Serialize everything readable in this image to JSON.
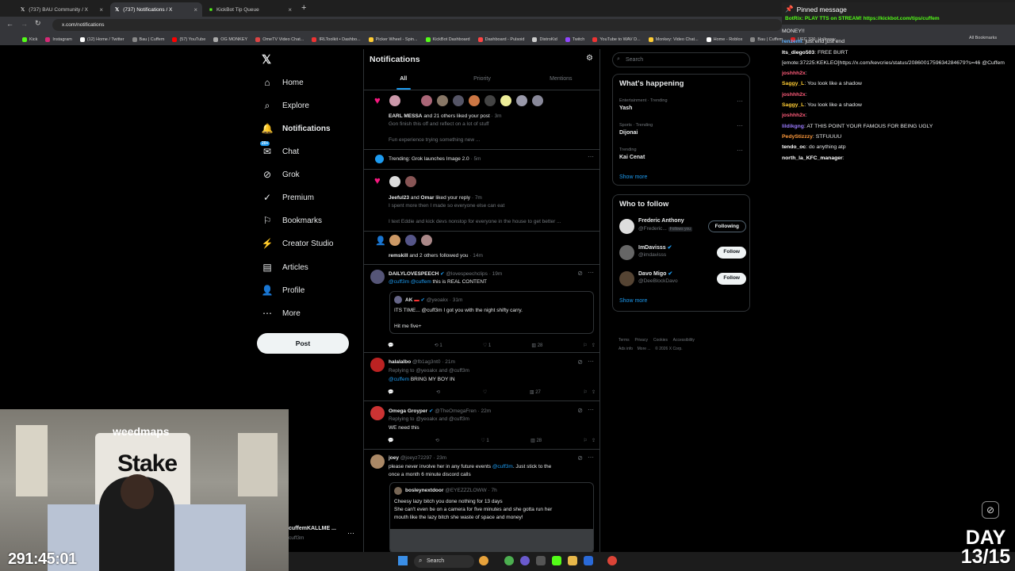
{
  "browser": {
    "tabs": [
      {
        "title": "(737) BAU Community / X",
        "active": false
      },
      {
        "title": "(737) Notifications / X",
        "active": true
      },
      {
        "title": "KickBot Tip Queue",
        "active": false
      }
    ],
    "new_tab": "+",
    "url": "x.com/notifications",
    "bookmarks": [
      "Kick",
      "Instagram",
      "(12) Home / Twitter",
      "Bau | Cuffem",
      "(57) YouTube",
      "OG MONKEY",
      "OmeTV Video Chat...",
      "IRLToolkit • Dashbo...",
      "Picker Wheel - Spin...",
      "KickBot Dashboard",
      "Dashboard - Pulsoid",
      "DistroKid",
      "Twitch",
      "YouTube to WAV D...",
      "Monkey: Video Chat...",
      "Home - Roblox",
      "Bau | Cuffem",
      "UFC 326: Holloway..."
    ],
    "all_bookmarks": "All Bookmarks"
  },
  "pinned": {
    "label": "Pinned message",
    "message": "BotRix: PLAY TTS on STREAM! https://kickbot.com/tips/cuffem"
  },
  "nav": {
    "items": [
      {
        "label": "Home",
        "icon": "home-icon"
      },
      {
        "label": "Explore",
        "icon": "search-icon"
      },
      {
        "label": "Notifications",
        "icon": "bell-icon"
      },
      {
        "label": "Chat",
        "icon": "chat-icon",
        "badge": "20+"
      },
      {
        "label": "Grok",
        "icon": "grok-icon"
      },
      {
        "label": "Premium",
        "icon": "premium-icon"
      },
      {
        "label": "Bookmarks",
        "icon": "bookmark-icon"
      },
      {
        "label": "Creator Studio",
        "icon": "creator-studio-icon"
      },
      {
        "label": "Articles",
        "icon": "articles-icon"
      },
      {
        "label": "Profile",
        "icon": "profile-icon"
      },
      {
        "label": "More",
        "icon": "more-icon"
      }
    ],
    "post": "Post",
    "account_name": "cuffemKALLME ...",
    "account_handle": "cuff3m"
  },
  "main": {
    "title": "Notifications",
    "tabs": [
      "All",
      "Priority",
      "Mentions"
    ],
    "n1": {
      "actor": "EARL MESSA",
      "action": "and 21 others liked your post",
      "time": "· 3m",
      "line1": "Gon finish this off and reflect on a lot of stuff",
      "line2": "Fun experience trying something new ..."
    },
    "n2": {
      "text": "Trending: Grok launches Image 2.0",
      "time": "· 5m"
    },
    "n3": {
      "actor": "Jeeful23",
      "and": "and",
      "actor2": "Omar",
      "action": "liked your reply",
      "time": "· 7m",
      "line1": "I spent more then I made so everyone else can eat",
      "line2": "I text Eddie and kick devs nonstop for everyone in the house to get better ..."
    },
    "n4": {
      "actor": "remskill",
      "action": "and 2 others followed you",
      "time": "· 14m"
    },
    "t1": {
      "name": "DAILYLOVESPEECH",
      "handle": "@lovespeechclips · 19m",
      "m1": "@cuff3m",
      "m2": "@cuffem",
      "text": "this is REAL CONTENT",
      "quote": {
        "name": "AK",
        "handle": "@yeoakx · 31m",
        "line1": "ITS TIME... @cuff3m I got you with the night shifty carry.",
        "line2": "Hit me five+"
      },
      "stats": {
        "retweets": "1",
        "likes": "1",
        "views": "28"
      }
    },
    "t2": {
      "name": "halalalbo",
      "handle": "@fb1ag3nt0 · 21m",
      "reply": "Replying to @yeoakx and @cuff3m",
      "mention": "@cuffem",
      "text": "BRING MY BOY IN",
      "stats": {
        "views": "27"
      }
    },
    "t3": {
      "name": "Omega Groyper",
      "handle": "@TheOmegaFren · 22m",
      "reply": "Replying to @yeoakx and @cuff3m",
      "text": "WE need this",
      "stats": {
        "likes": "1",
        "views": "28"
      }
    },
    "t4": {
      "name": "joey",
      "handle": "@joeyz72297 · 23m",
      "t1": "please never involve her in any future events",
      "mention": "@cuff3m",
      "t2": ". Just stick to the",
      "t3": "once a month 6 minute discord calls",
      "quote": {
        "name": "bosleynextdoor",
        "handle": "@EYEZZZLOWW · 7h",
        "l1": "Cheesy lazy bitch you done nothing for 13  days",
        "l2": "She can't even be on a camera for five minutes and she gotta run her",
        "l3": "mouth like the lazy bitch she waste of space and money!"
      }
    }
  },
  "right": {
    "search_placeholder": "Search",
    "happening_title": "What's happening",
    "trends": [
      {
        "category": "Entertainment · Trending",
        "name": "Yash"
      },
      {
        "category": "Sports · Trending",
        "name": "Dijonai"
      },
      {
        "category": "Trending",
        "name": "Kai Cenat"
      }
    ],
    "show_more": "Show more",
    "follow_title": "Who to follow",
    "who": [
      {
        "name": "Frederic Anthony",
        "handle": "@Frederic...",
        "tag": "Follows you",
        "button": "Following"
      },
      {
        "name": "ImDavisss",
        "handle": "@imdavisss",
        "button": "Follow"
      },
      {
        "name": "Davo Migo",
        "handle": "@DeeBlockDavo",
        "button": "Follow"
      }
    ],
    "footer1": "Terms     Privacy     Cookies     Accessibility",
    "footer2": "Ads info    More ...    © 2026 X Corp."
  },
  "chat": {
    "lines": [
      {
        "user": "",
        "text": "MONEY!!",
        "color": "#ffffff"
      },
      {
        "user": "renzemi",
        "text": "just end just end",
        "color": "#5fb0ff"
      },
      {
        "user": "Its_diego503",
        "text": "FREE BURT [emote:37225:KEKLEO]https://x.com/kevcries/status/2086001759634284679?s=46 @Cuffem",
        "color": "#ffffff"
      },
      {
        "user": "joshhh2x",
        "text": "",
        "color": "#ff5c7a"
      },
      {
        "user": "Saggy_L",
        "text": "You look like a shadow",
        "color": "#ffcc33"
      },
      {
        "user": "joshhh2x",
        "text": "",
        "color": "#ff5c7a"
      },
      {
        "user": "Saggy_L",
        "text": "You look like a shadow",
        "color": "#ffcc33"
      },
      {
        "user": "joshhh2x",
        "text": "",
        "color": "#ff5c7a"
      },
      {
        "user": "lildikgng",
        "text": "AT THIS POINT YOUR FAMOUS FOR BEING UGLY",
        "color": "#9b7bff"
      },
      {
        "user": "PedyStizzzy",
        "text": "STFUUUU",
        "color": "#ff9a3c"
      },
      {
        "user": "tendo_oc",
        "text": "do anything atp",
        "color": "#ffffff"
      },
      {
        "user": "north_la_KFC_manager",
        "text": "",
        "color": "#ffffff"
      }
    ]
  },
  "overlay": {
    "cam_text1": "weedmaps",
    "cam_text2": "Stake",
    "timer": "291:45:01",
    "day": "DAY",
    "day_count": "13/15"
  },
  "taskbar": {
    "search": "Search"
  }
}
